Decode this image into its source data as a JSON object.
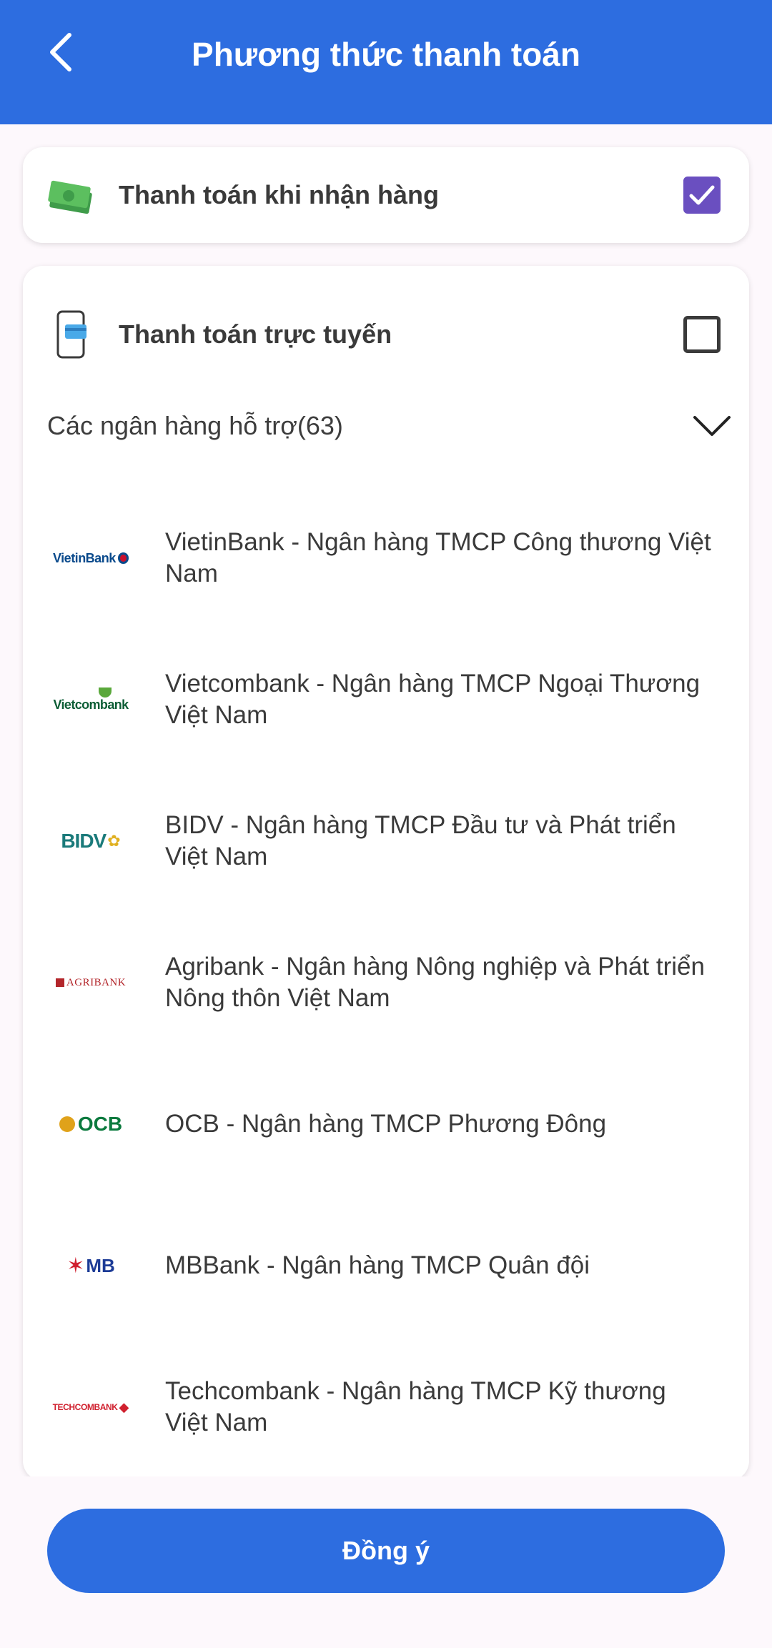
{
  "header": {
    "title": "Phương thức thanh toán",
    "back_icon": "chevron-left-icon"
  },
  "cod": {
    "label": "Thanh toán khi nhận hàng",
    "checked": true,
    "icon": "cash-icon"
  },
  "online": {
    "label": "Thanh toán trực tuyến",
    "checked": false,
    "icon": "mobile-card-icon",
    "banks_header": "Các ngân hàng hỗ trợ(63)",
    "banks": [
      {
        "logo": "VietinBank",
        "name": "VietinBank - Ngân hàng TMCP Công thương Việt Nam"
      },
      {
        "logo": "Vietcombank",
        "name": "Vietcombank - Ngân hàng TMCP Ngoại Thương Việt Nam"
      },
      {
        "logo": "BIDV",
        "name": "BIDV - Ngân hàng TMCP Đầu tư và Phát triển Việt Nam"
      },
      {
        "logo": "AGRIBANK",
        "name": "Agribank - Ngân hàng Nông nghiệp và Phát triển Nông thôn Việt Nam"
      },
      {
        "logo": "OCB",
        "name": "OCB - Ngân hàng TMCP Phương Đông"
      },
      {
        "logo": "MB",
        "name": "MBBank - Ngân hàng TMCP Quân đội"
      },
      {
        "logo": "TECHCOMBANK",
        "name": "Techcombank - Ngân hàng TMCP Kỹ thương Việt Nam"
      }
    ]
  },
  "footer": {
    "agree_label": "Đồng ý"
  },
  "colors": {
    "primary": "#2d6de0",
    "checkbox_checked": "#6a4fc0",
    "background": "#fdf8fc"
  }
}
